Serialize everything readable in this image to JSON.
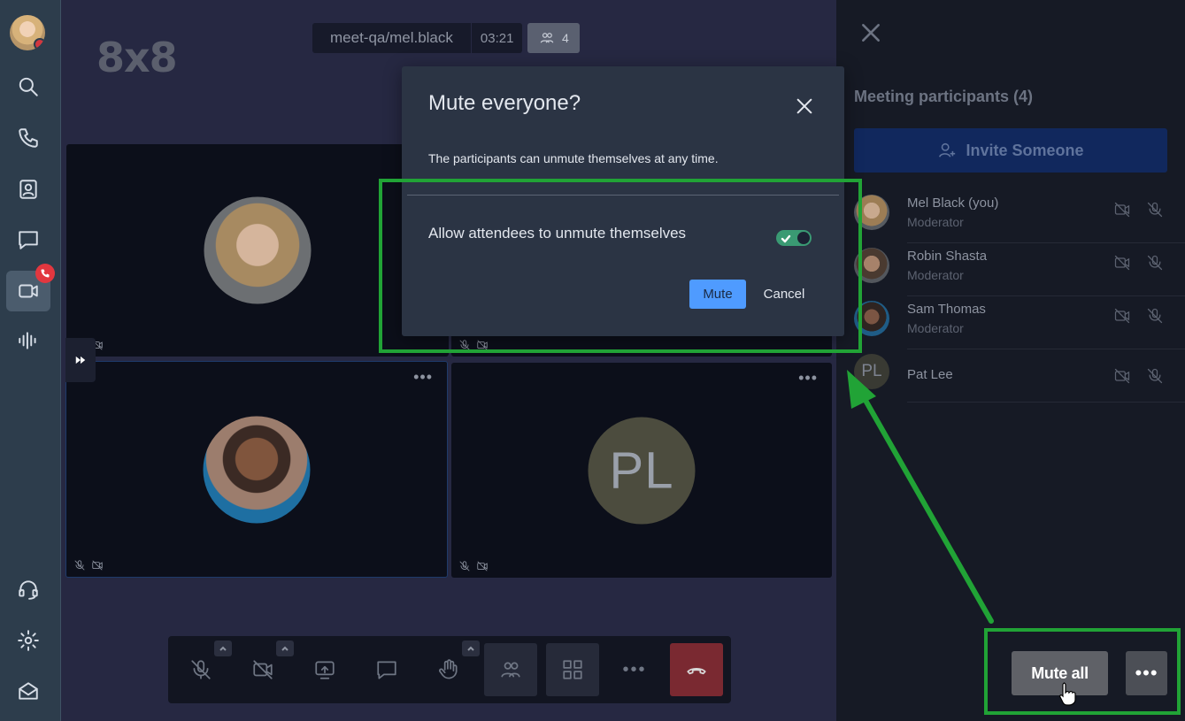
{
  "rail": {
    "items": [
      {
        "name": "search-icon"
      },
      {
        "name": "phone-icon"
      },
      {
        "name": "contacts-icon"
      },
      {
        "name": "chat-icon"
      },
      {
        "name": "video-icon",
        "active": true
      },
      {
        "name": "voicemail-icon"
      },
      {
        "name": "headset-icon"
      },
      {
        "name": "settings-icon"
      },
      {
        "name": "mail-icon"
      }
    ]
  },
  "meeting": {
    "logo": "8x8",
    "room": "meet-qa/mel.black",
    "timer": "03:21",
    "participant_count": "4"
  },
  "tiles": [
    {
      "initials": ""
    },
    {
      "initials": ""
    },
    {
      "initials": "PL"
    }
  ],
  "panel": {
    "title": "Meeting participants (4)",
    "invite_label": "Invite Someone",
    "participants": [
      {
        "name": "Mel Black (you)",
        "role": "Moderator"
      },
      {
        "name": "Robin Shasta",
        "role": "Moderator"
      },
      {
        "name": "Sam Thomas",
        "role": "Moderator"
      },
      {
        "name": "Pat Lee",
        "role": "",
        "initials": "PL"
      }
    ],
    "mute_all_label": "Mute all",
    "more_label": "•••"
  },
  "modal": {
    "title": "Mute everyone?",
    "description": "The participants can unmute themselves at any time.",
    "toggle_label": "Allow attendees to unmute themselves",
    "toggle_on": true,
    "mute_label": "Mute",
    "cancel_label": "Cancel"
  },
  "colors": {
    "annotation": "#21a336",
    "primary_button": "#4f9bff",
    "toggle_on": "#3a9a73",
    "hangup": "#7a2931"
  }
}
